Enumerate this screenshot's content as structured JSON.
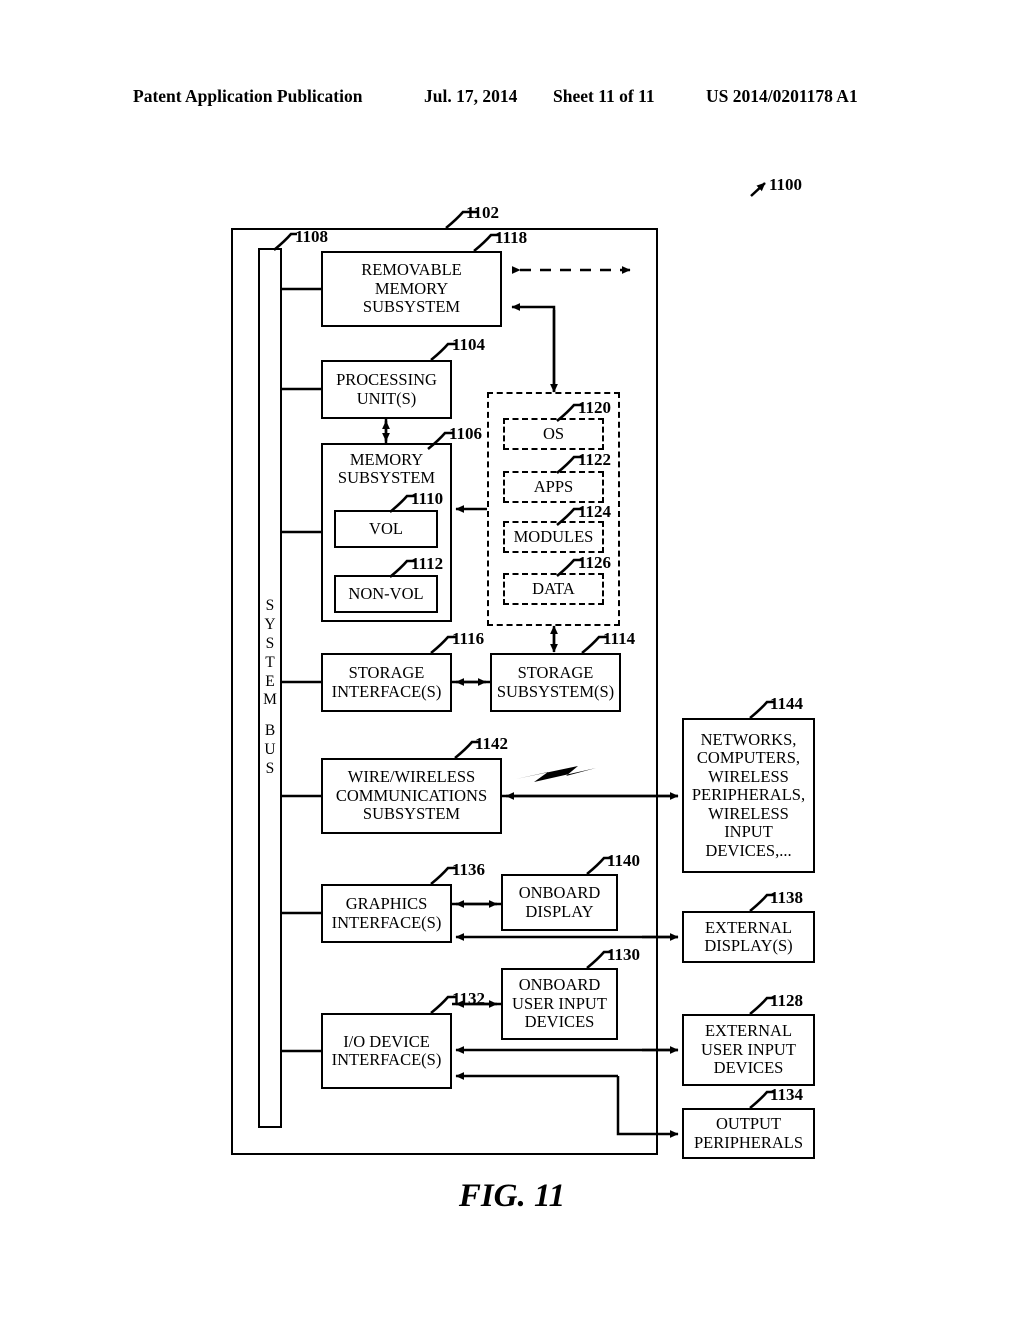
{
  "header": {
    "publication": "Patent Application Publication",
    "date": "Jul. 17, 2014",
    "sheet": "Sheet 11 of 11",
    "patent_number": "US 2014/0201178 A1"
  },
  "figure": {
    "caption": "FIG. 11",
    "system_ref": "1100"
  },
  "bus": {
    "ref": "1108",
    "line1": "SYSTEM",
    "line2": "BUS"
  },
  "enclosure": {
    "ref": "1102"
  },
  "blocks": {
    "removable_memory": {
      "ref": "1118",
      "label": "REMOVABLE\nMEMORY\nSUBSYSTEM"
    },
    "processing_unit": {
      "ref": "1104",
      "label": "PROCESSING\nUNIT(S)"
    },
    "memory_subsystem": {
      "ref": "1106",
      "label": "MEMORY\nSUBSYSTEM"
    },
    "vol": {
      "ref": "1110",
      "label": "VOL"
    },
    "non_vol": {
      "ref": "1112",
      "label": "NON-VOL"
    },
    "storage_interface": {
      "ref": "1116",
      "label": "STORAGE\nINTERFACE(S)"
    },
    "storage_subsystem": {
      "ref": "1114",
      "label": "STORAGE\nSUBSYSTEM(S)"
    },
    "communications": {
      "ref": "1142",
      "label": "WIRE/WIRELESS\nCOMMUNICATIONS\nSUBSYSTEM"
    },
    "graphics_interface": {
      "ref": "1136",
      "label": "GRAPHICS\nINTERFACE(S)"
    },
    "onboard_display": {
      "ref": "1140",
      "label": "ONBOARD\nDISPLAY"
    },
    "io_interface": {
      "ref": "1132",
      "label": "I/O DEVICE\nINTERFACE(S)"
    },
    "onboard_input": {
      "ref": "1130",
      "label": "ONBOARD\nUSER INPUT\nDEVICES"
    },
    "networks": {
      "ref": "1144",
      "label": "NETWORKS,\nCOMPUTERS,\nWIRELESS\nPERIPHERALS,\nWIRELESS\nINPUT\nDEVICES,..."
    },
    "external_display": {
      "ref": "1138",
      "label": "EXTERNAL\nDISPLAY(S)"
    },
    "external_input": {
      "ref": "1128",
      "label": "EXTERNAL\nUSER INPUT\nDEVICES"
    },
    "output_peripherals": {
      "ref": "1134",
      "label": "OUTPUT\nPERIPHERALS"
    }
  },
  "memory_contents": {
    "os": {
      "ref": "1120",
      "label": "OS"
    },
    "apps": {
      "ref": "1122",
      "label": "APPS"
    },
    "modules": {
      "ref": "1124",
      "label": "MODULES"
    },
    "data": {
      "ref": "1126",
      "label": "DATA"
    }
  },
  "icons": {
    "wireless_bolt": "lightning-bolt-icon"
  },
  "colors": {
    "ink": "#000000",
    "paper": "#ffffff"
  }
}
